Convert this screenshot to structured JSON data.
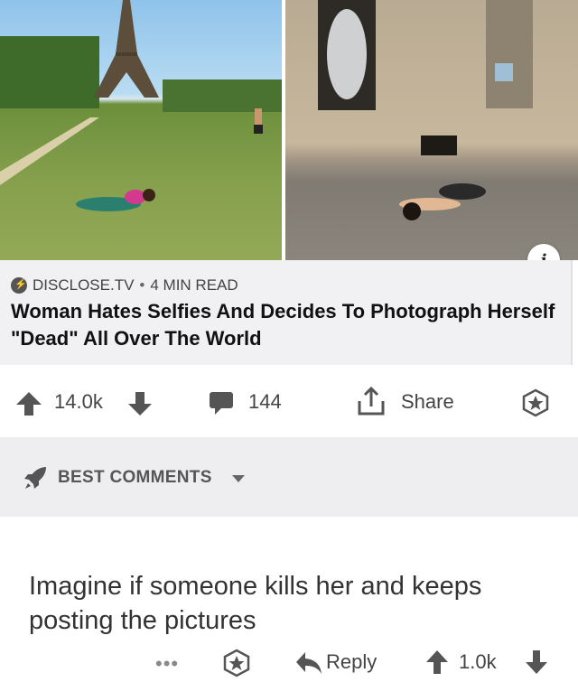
{
  "post": {
    "source": "DISCLOSE.TV",
    "separator": "•",
    "read_time": "4 MIN READ",
    "title": "Woman Hates Selfies And Decides To Photograph Herself \"Dead\" All Over The World",
    "upvotes": "14.0k",
    "comments": "144",
    "share_label": "Share"
  },
  "section": {
    "label": "BEST COMMENTS"
  },
  "comment": {
    "text": "Imagine if someone kills her and keeps posting the pictures",
    "more": "•••",
    "reply_label": "Reply",
    "score": "1.0k"
  },
  "icons": {
    "info": "info-icon",
    "upvote": "arrow-up-icon",
    "downvote": "arrow-down-icon",
    "comment": "speech-bubble-icon",
    "share": "share-icon",
    "award": "star-award-icon",
    "sort": "rocket-icon",
    "reply": "reply-arrow-icon"
  },
  "colors": {
    "card_bg": "#f1f1f3",
    "section_bg": "#eeeef0",
    "icon": "#555555"
  }
}
